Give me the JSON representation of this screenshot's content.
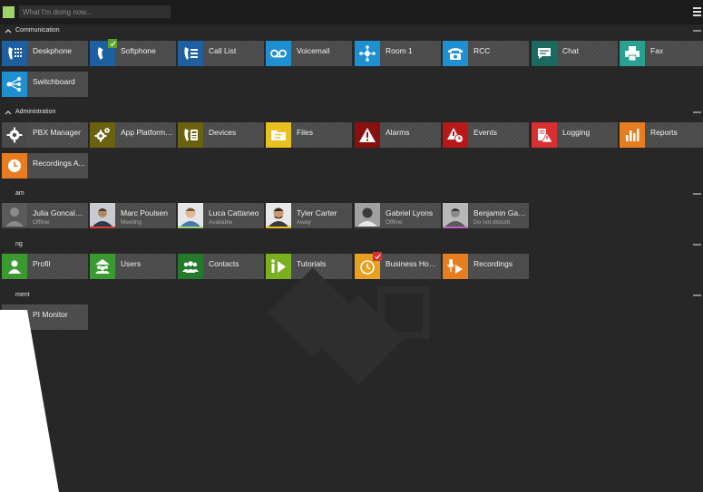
{
  "topbar": {
    "status_placeholder": "What I'm doing now..."
  },
  "sections": {
    "communication": "Communication",
    "administration": "Administration",
    "team": "am",
    "setting": "ng",
    "development": "ment"
  },
  "tiles": {
    "deskphone": "Deskphone",
    "softphone": "Softphone",
    "call_list": "Call List",
    "voicemail": "Voicemail",
    "room1": "Room 1",
    "rcc": "RCC",
    "chat": "Chat",
    "fax": "Fax",
    "switchboard": "Switchboard",
    "pbx_manager": "PBX Manager",
    "app_platform": "App Platform ...",
    "devices": "Devices",
    "files": "Files",
    "alarms": "Alarms",
    "events": "Events",
    "logging": "Logging",
    "reports": "Reports",
    "recordings_admin": "Recordings A...",
    "profil": "Profil",
    "users": "Users",
    "contacts": "Contacts",
    "tutorials": "Tutorials",
    "business_hours": "Business Hours",
    "recordings": "Recordings",
    "api_monitor": "PI Monitor"
  },
  "people": [
    {
      "name": "Julia Goncalve...",
      "status": "Offline"
    },
    {
      "name": "Marc Poulsen",
      "status": "Meeting"
    },
    {
      "name": "Luca Cattaneo",
      "status": "Available"
    },
    {
      "name": "Tyler Carter",
      "status": "Away"
    },
    {
      "name": "Gabriel Lyons",
      "status": "Offline"
    },
    {
      "name": "Benjamin Gail...",
      "status": "Do not disturb"
    }
  ],
  "colors": {
    "background": "#272727",
    "topbar": "#1c1c1c",
    "tile": "#4a4a4a",
    "blue": "#1e5fa0",
    "sky": "#1e8fd0",
    "olive": "#6b6210",
    "yellow": "#e8c020",
    "darkred": "#8a1010",
    "red": "#d82020",
    "orange": "#e87d20",
    "green": "#3a9a30",
    "darkgreen": "#237a2a",
    "lime": "#7ab020",
    "teal": "#1a6a60",
    "presence_available": "#9fd46b",
    "presence_meeting": "#d83c3c",
    "presence_away": "#e8c020",
    "presence_dnd": "#c060c0"
  },
  "icons": {
    "deskphone": "dialpad-phone-icon",
    "softphone": "phone-handset-icon",
    "call_list": "call-list-icon",
    "voicemail": "voicemail-icon",
    "room1": "network-room-icon",
    "rcc": "desk-telephone-icon",
    "chat": "chat-bubble-icon",
    "fax": "printer-icon",
    "switchboard": "switchboard-icon",
    "pbx_manager": "gear-icon",
    "app_platform": "gears-icon",
    "devices": "device-icon",
    "files": "folder-icon",
    "alarms": "warning-icon",
    "events": "event-clock-icon",
    "logging": "log-warning-icon",
    "reports": "bar-chart-icon",
    "recordings_admin": "clock-icon",
    "users": "users-icon",
    "contacts": "contacts-icon",
    "tutorials": "info-play-icon",
    "business_hours": "clock-icon",
    "recordings": "microphone-play-icon"
  }
}
